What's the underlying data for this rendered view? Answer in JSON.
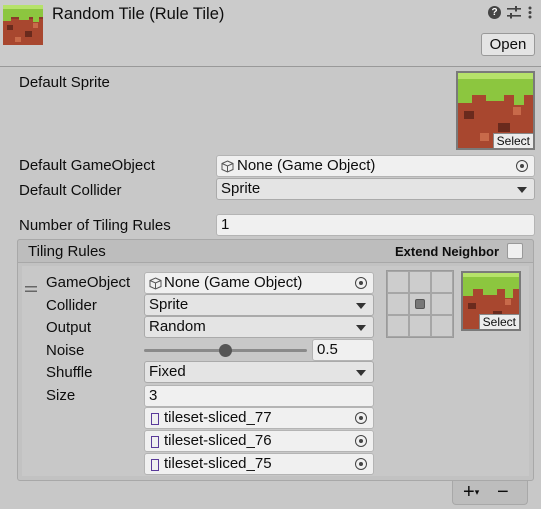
{
  "header": {
    "title": "Random Tile (Rule Tile)",
    "open_button": "Open",
    "icons": [
      "help-icon",
      "settings-sliders-icon",
      "more-icon"
    ]
  },
  "default_sprite": {
    "label": "Default Sprite",
    "select_label": "Select"
  },
  "default_gameobject": {
    "label": "Default GameObject",
    "value": "None (Game Object)"
  },
  "default_collider": {
    "label": "Default Collider",
    "value": "Sprite"
  },
  "num_tiling_rules": {
    "label": "Number of Tiling Rules",
    "value": "1"
  },
  "tiling_rules": {
    "title": "Tiling Rules",
    "extend_neighbor_label": "Extend Neighbor",
    "extend_neighbor_checked": false,
    "rule": {
      "gameobject_label": "GameObject",
      "gameobject_value": "None (Game Object)",
      "collider_label": "Collider",
      "collider_value": "Sprite",
      "output_label": "Output",
      "output_value": "Random",
      "noise_label": "Noise",
      "noise_value": "0.5",
      "shuffle_label": "Shuffle",
      "shuffle_value": "Fixed",
      "size_label": "Size",
      "size_value": "3",
      "sprites": [
        "tileset-sliced_77",
        "tileset-sliced_76",
        "tileset-sliced_75"
      ],
      "select_label": "Select"
    }
  },
  "footer": {
    "add": "+",
    "add_dropdown": "▾",
    "remove": "−"
  }
}
